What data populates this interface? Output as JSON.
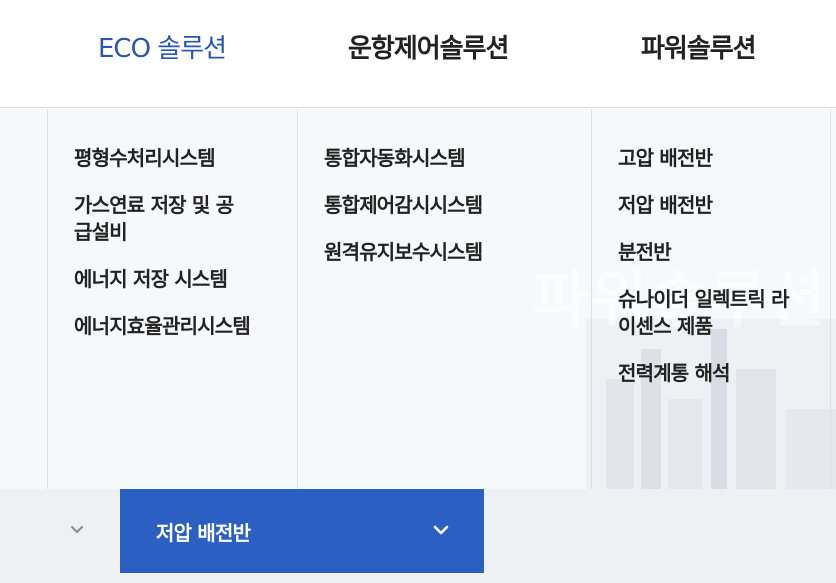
{
  "top_tabs": [
    {
      "label": "ECO 솔루션",
      "active": true
    },
    {
      "label": "운항제어솔루션",
      "active": false
    },
    {
      "label": "파워솔루션",
      "active": false
    }
  ],
  "menu": {
    "eco": [
      "평형수처리시스템",
      "가스연료 저장 및 공급설비",
      "에너지 저장 시스템",
      "에너지효율관리시스템"
    ],
    "navigation": [
      "통합자동화시스템",
      "통합제어감시시스템",
      "원격유지보수시스템"
    ],
    "power": [
      "고압 배전반",
      "저압 배전반",
      "분전반",
      "슈나이더 일렉트릭 라이센스 제품",
      "전력계통 해석"
    ]
  },
  "background_text": "파워솔루션",
  "bottom_bar": {
    "selected_label": "저압 배전반",
    "home_icon": "chevron-down-icon",
    "select_icon": "chevron-down-icon"
  },
  "colors": {
    "accent": "#2a55b3",
    "dropdown_bg": "#2b5fc1",
    "menu_bg": "#f7f8fa",
    "bar_bg": "#eef0f4"
  }
}
